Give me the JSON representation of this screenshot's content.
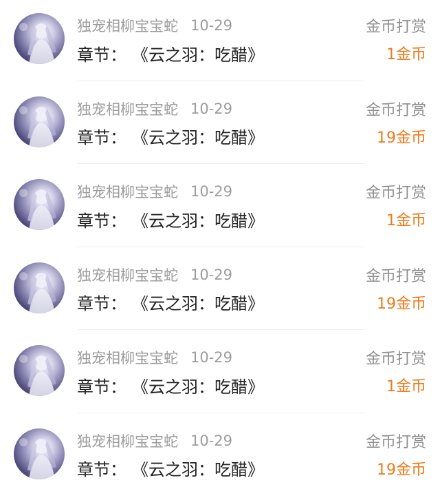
{
  "colors": {
    "meta_text": "#9c9c9c",
    "chapter_text": "#222222",
    "amount_text": "#f07a1a",
    "divider": "#eeeeee"
  },
  "records": [
    {
      "user": "独宠相柳宝宝蛇",
      "date": "10-29",
      "chapter_label": "章节：",
      "chapter_title": "《云之羽：吃醋》",
      "type": "金币打赏",
      "amount": "1金币",
      "avatar_icon": "user-avatar-icon"
    },
    {
      "user": "独宠相柳宝宝蛇",
      "date": "10-29",
      "chapter_label": "章节：",
      "chapter_title": "《云之羽：吃醋》",
      "type": "金币打赏",
      "amount": "19金币",
      "avatar_icon": "user-avatar-icon"
    },
    {
      "user": "独宠相柳宝宝蛇",
      "date": "10-29",
      "chapter_label": "章节：",
      "chapter_title": "《云之羽：吃醋》",
      "type": "金币打赏",
      "amount": "1金币",
      "avatar_icon": "user-avatar-icon"
    },
    {
      "user": "独宠相柳宝宝蛇",
      "date": "10-29",
      "chapter_label": "章节：",
      "chapter_title": "《云之羽：吃醋》",
      "type": "金币打赏",
      "amount": "19金币",
      "avatar_icon": "user-avatar-icon"
    },
    {
      "user": "独宠相柳宝宝蛇",
      "date": "10-29",
      "chapter_label": "章节：",
      "chapter_title": "《云之羽：吃醋》",
      "type": "金币打赏",
      "amount": "1金币",
      "avatar_icon": "user-avatar-icon"
    },
    {
      "user": "独宠相柳宝宝蛇",
      "date": "10-29",
      "chapter_label": "章节：",
      "chapter_title": "《云之羽：吃醋》",
      "type": "金币打赏",
      "amount": "19金币",
      "avatar_icon": "user-avatar-icon"
    }
  ]
}
